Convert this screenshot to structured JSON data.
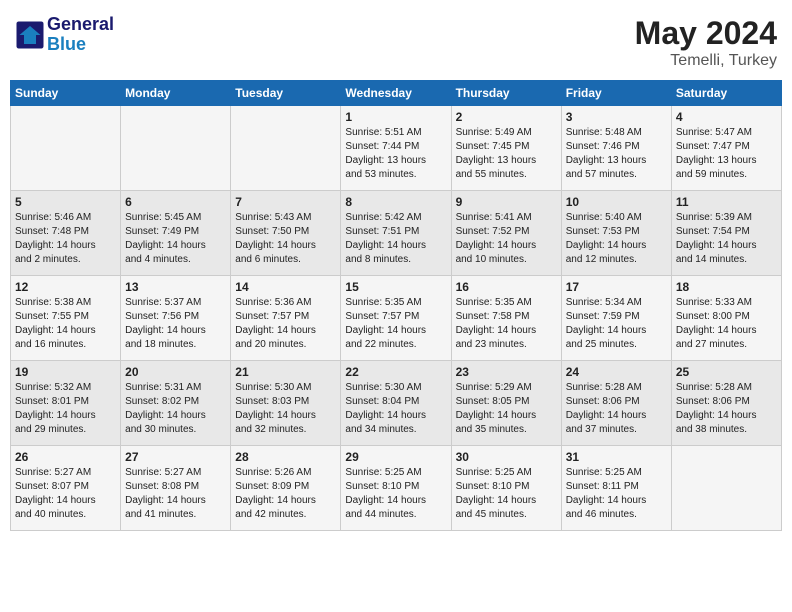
{
  "header": {
    "logo_line1": "General",
    "logo_line2": "Blue",
    "title": "May 2024",
    "location": "Temelli, Turkey"
  },
  "weekdays": [
    "Sunday",
    "Monday",
    "Tuesday",
    "Wednesday",
    "Thursday",
    "Friday",
    "Saturday"
  ],
  "weeks": [
    [
      {
        "day": "",
        "info": ""
      },
      {
        "day": "",
        "info": ""
      },
      {
        "day": "",
        "info": ""
      },
      {
        "day": "1",
        "info": "Sunrise: 5:51 AM\nSunset: 7:44 PM\nDaylight: 13 hours\nand 53 minutes."
      },
      {
        "day": "2",
        "info": "Sunrise: 5:49 AM\nSunset: 7:45 PM\nDaylight: 13 hours\nand 55 minutes."
      },
      {
        "day": "3",
        "info": "Sunrise: 5:48 AM\nSunset: 7:46 PM\nDaylight: 13 hours\nand 57 minutes."
      },
      {
        "day": "4",
        "info": "Sunrise: 5:47 AM\nSunset: 7:47 PM\nDaylight: 13 hours\nand 59 minutes."
      }
    ],
    [
      {
        "day": "5",
        "info": "Sunrise: 5:46 AM\nSunset: 7:48 PM\nDaylight: 14 hours\nand 2 minutes."
      },
      {
        "day": "6",
        "info": "Sunrise: 5:45 AM\nSunset: 7:49 PM\nDaylight: 14 hours\nand 4 minutes."
      },
      {
        "day": "7",
        "info": "Sunrise: 5:43 AM\nSunset: 7:50 PM\nDaylight: 14 hours\nand 6 minutes."
      },
      {
        "day": "8",
        "info": "Sunrise: 5:42 AM\nSunset: 7:51 PM\nDaylight: 14 hours\nand 8 minutes."
      },
      {
        "day": "9",
        "info": "Sunrise: 5:41 AM\nSunset: 7:52 PM\nDaylight: 14 hours\nand 10 minutes."
      },
      {
        "day": "10",
        "info": "Sunrise: 5:40 AM\nSunset: 7:53 PM\nDaylight: 14 hours\nand 12 minutes."
      },
      {
        "day": "11",
        "info": "Sunrise: 5:39 AM\nSunset: 7:54 PM\nDaylight: 14 hours\nand 14 minutes."
      }
    ],
    [
      {
        "day": "12",
        "info": "Sunrise: 5:38 AM\nSunset: 7:55 PM\nDaylight: 14 hours\nand 16 minutes."
      },
      {
        "day": "13",
        "info": "Sunrise: 5:37 AM\nSunset: 7:56 PM\nDaylight: 14 hours\nand 18 minutes."
      },
      {
        "day": "14",
        "info": "Sunrise: 5:36 AM\nSunset: 7:57 PM\nDaylight: 14 hours\nand 20 minutes."
      },
      {
        "day": "15",
        "info": "Sunrise: 5:35 AM\nSunset: 7:57 PM\nDaylight: 14 hours\nand 22 minutes."
      },
      {
        "day": "16",
        "info": "Sunrise: 5:35 AM\nSunset: 7:58 PM\nDaylight: 14 hours\nand 23 minutes."
      },
      {
        "day": "17",
        "info": "Sunrise: 5:34 AM\nSunset: 7:59 PM\nDaylight: 14 hours\nand 25 minutes."
      },
      {
        "day": "18",
        "info": "Sunrise: 5:33 AM\nSunset: 8:00 PM\nDaylight: 14 hours\nand 27 minutes."
      }
    ],
    [
      {
        "day": "19",
        "info": "Sunrise: 5:32 AM\nSunset: 8:01 PM\nDaylight: 14 hours\nand 29 minutes."
      },
      {
        "day": "20",
        "info": "Sunrise: 5:31 AM\nSunset: 8:02 PM\nDaylight: 14 hours\nand 30 minutes."
      },
      {
        "day": "21",
        "info": "Sunrise: 5:30 AM\nSunset: 8:03 PM\nDaylight: 14 hours\nand 32 minutes."
      },
      {
        "day": "22",
        "info": "Sunrise: 5:30 AM\nSunset: 8:04 PM\nDaylight: 14 hours\nand 34 minutes."
      },
      {
        "day": "23",
        "info": "Sunrise: 5:29 AM\nSunset: 8:05 PM\nDaylight: 14 hours\nand 35 minutes."
      },
      {
        "day": "24",
        "info": "Sunrise: 5:28 AM\nSunset: 8:06 PM\nDaylight: 14 hours\nand 37 minutes."
      },
      {
        "day": "25",
        "info": "Sunrise: 5:28 AM\nSunset: 8:06 PM\nDaylight: 14 hours\nand 38 minutes."
      }
    ],
    [
      {
        "day": "26",
        "info": "Sunrise: 5:27 AM\nSunset: 8:07 PM\nDaylight: 14 hours\nand 40 minutes."
      },
      {
        "day": "27",
        "info": "Sunrise: 5:27 AM\nSunset: 8:08 PM\nDaylight: 14 hours\nand 41 minutes."
      },
      {
        "day": "28",
        "info": "Sunrise: 5:26 AM\nSunset: 8:09 PM\nDaylight: 14 hours\nand 42 minutes."
      },
      {
        "day": "29",
        "info": "Sunrise: 5:25 AM\nSunset: 8:10 PM\nDaylight: 14 hours\nand 44 minutes."
      },
      {
        "day": "30",
        "info": "Sunrise: 5:25 AM\nSunset: 8:10 PM\nDaylight: 14 hours\nand 45 minutes."
      },
      {
        "day": "31",
        "info": "Sunrise: 5:25 AM\nSunset: 8:11 PM\nDaylight: 14 hours\nand 46 minutes."
      },
      {
        "day": "",
        "info": ""
      }
    ]
  ]
}
